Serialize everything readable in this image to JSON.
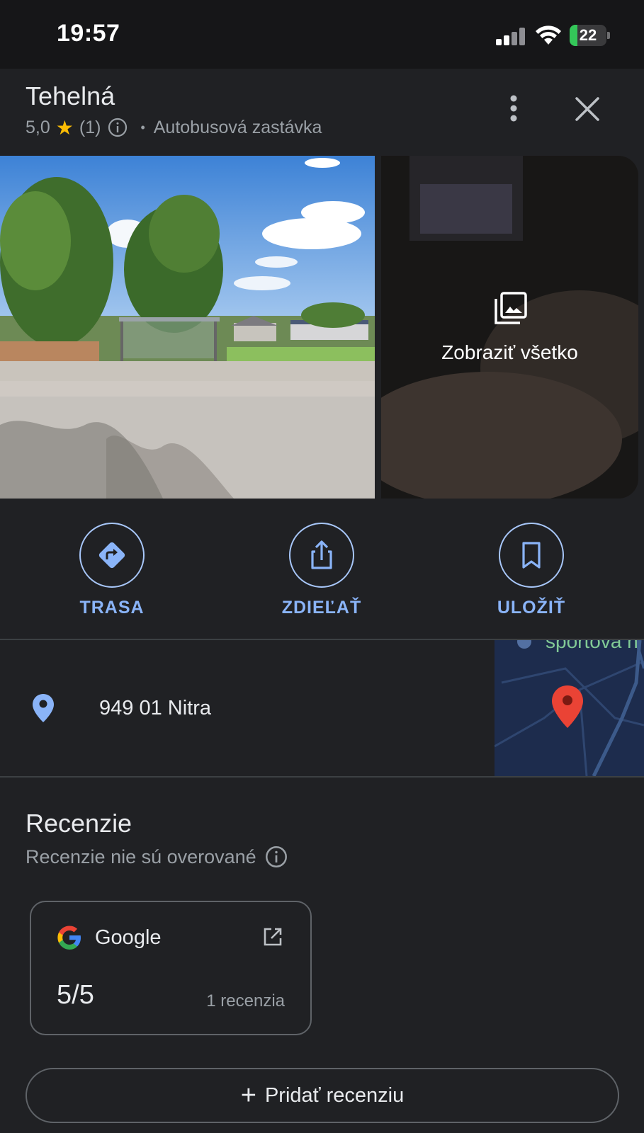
{
  "status_bar": {
    "time": "19:57",
    "battery": "22",
    "battery_level": 0.22
  },
  "place": {
    "name": "Tehelná",
    "rating": "5,0",
    "rating_count": "(1)",
    "category": "Autobusová zastávka"
  },
  "icons": {
    "star": "star-icon",
    "info": "info-icon",
    "more": "more-vert-icon",
    "close": "close-icon",
    "gallery": "photo-library-icon",
    "directions": "directions-icon",
    "share": "share-icon",
    "save": "bookmark-icon",
    "pin": "location-pin-icon",
    "external": "open-in-new-icon"
  },
  "photos": {
    "view_all_label": "Zobraziť všetko"
  },
  "actions": [
    {
      "label": "TRASA"
    },
    {
      "label": "ZDIEĽAŤ"
    },
    {
      "label": "ULOŽIŤ"
    }
  ],
  "address": {
    "text": "949 01 Nitra",
    "map_label": "športová h"
  },
  "reviews": {
    "title": "Recenzie",
    "subtitle": "Recenzie nie sú overované",
    "source": "Google",
    "score": "5/5",
    "count": "1 recenzia",
    "add_label": "Pridať recenziu"
  },
  "colors": {
    "background": "#202124",
    "accent": "#8ab4f8",
    "star": "#fbbc04",
    "battery": "#34c759",
    "pin_marker": "#ea4335"
  }
}
